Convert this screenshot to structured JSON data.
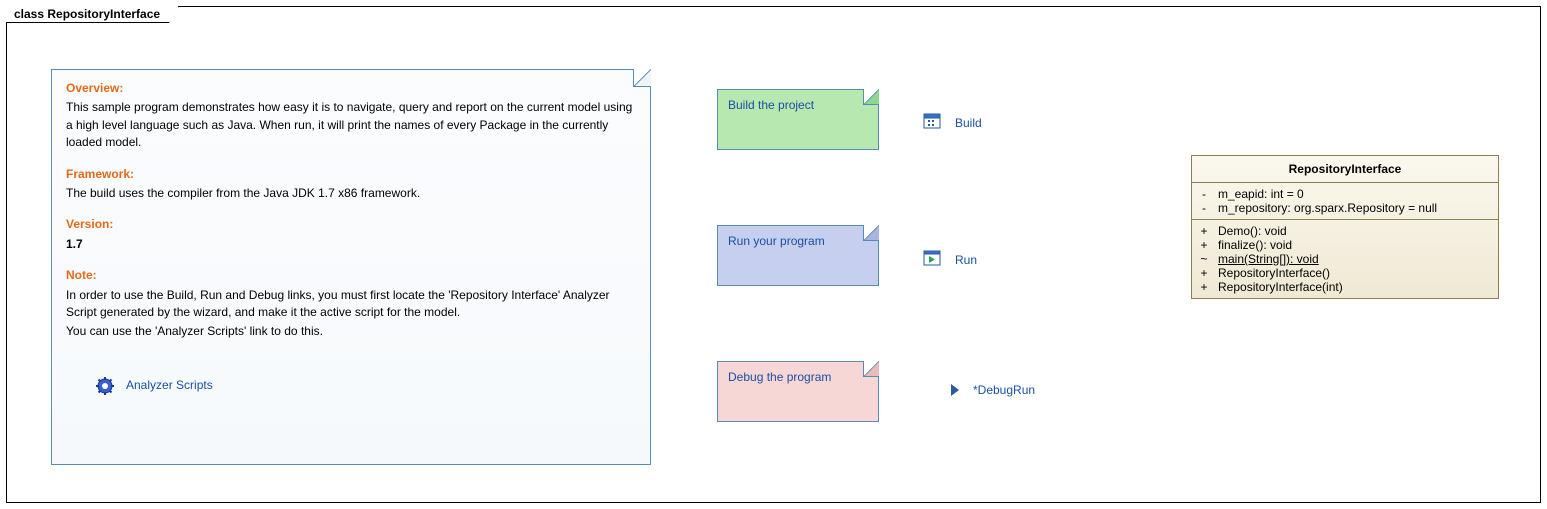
{
  "frame_title": "class RepositoryInterface",
  "note": {
    "overview_hdr": "Overview:",
    "overview_body": "This sample program demonstrates how easy it is to navigate, query and report on the current model using a high level language such as Java. When run, it will print the names of every Package in the currently loaded model.",
    "framework_hdr": "Framework:",
    "framework_body": "The build uses the compiler from the Java JDK 1.7 x86 framework.",
    "version_hdr": "Version:",
    "version_val": "1.7",
    "note_hdr": "Note:",
    "note_body1": "In order to use the Build, Run and Debug links, you must first locate the 'Repository Interface' Analyzer Script generated by the wizard, and make it the active script for the model.",
    "note_body2": "You can use the 'Analyzer Scripts' link to do this.",
    "analyzer_link": "Analyzer Scripts"
  },
  "stickies": {
    "build": "Build the project",
    "run": "Run your program",
    "debug": "Debug the program"
  },
  "actions": {
    "build": "Build",
    "run": "Run",
    "debug": "*DebugRun"
  },
  "class": {
    "name": "RepositoryInterface",
    "attrs": [
      {
        "vis": "-",
        "sig": "m_eapid: int = 0"
      },
      {
        "vis": "-",
        "sig": "m_repository: org.sparx.Repository = null"
      }
    ],
    "ops": [
      {
        "vis": "+",
        "sig": "Demo(): void",
        "static": false
      },
      {
        "vis": "+",
        "sig": "finalize(): void",
        "static": false
      },
      {
        "vis": "~",
        "sig": "main(String[]): void",
        "static": true
      },
      {
        "vis": "+",
        "sig": "RepositoryInterface()",
        "static": false
      },
      {
        "vis": "+",
        "sig": "RepositoryInterface(int)",
        "static": false
      }
    ]
  }
}
